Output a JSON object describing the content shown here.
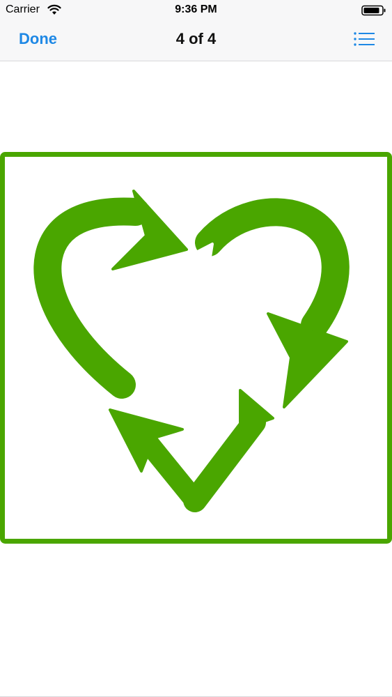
{
  "status_bar": {
    "carrier": "Carrier",
    "time": "9:36 PM",
    "wifi_icon": "wifi-icon",
    "battery_icon": "battery-icon"
  },
  "nav_bar": {
    "done_label": "Done",
    "title": "4 of 4",
    "list_icon": "list-icon"
  },
  "colors": {
    "accent": "#1e88e5",
    "image_green": "#4aa600",
    "bar_background": "#f7f7f8"
  },
  "preview": {
    "icon": "recycle-heart-icon"
  }
}
